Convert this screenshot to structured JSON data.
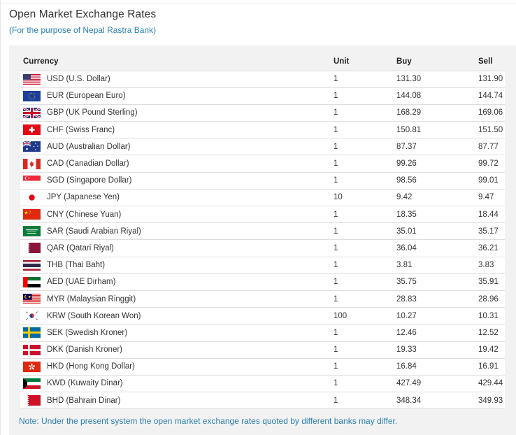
{
  "header": {
    "title": "Open Market Exchange Rates",
    "subtitle": "(For the purpose of Nepal Rastra Bank)"
  },
  "table": {
    "columns": {
      "currency": "Currency",
      "unit": "Unit",
      "buy": "Buy",
      "sell": "Sell"
    },
    "rows": [
      {
        "flag": "us-flag-icon",
        "name": "USD (U.S. Dollar)",
        "unit": "1",
        "buy": "131.30",
        "sell": "131.90"
      },
      {
        "flag": "eu-flag-icon",
        "name": "EUR (European Euro)",
        "unit": "1",
        "buy": "144.08",
        "sell": "144.74"
      },
      {
        "flag": "gb-flag-icon",
        "name": "GBP (UK Pound Sterling)",
        "unit": "1",
        "buy": "168.29",
        "sell": "169.06"
      },
      {
        "flag": "ch-flag-icon",
        "name": "CHF (Swiss Franc)",
        "unit": "1",
        "buy": "150.81",
        "sell": "151.50"
      },
      {
        "flag": "au-flag-icon",
        "name": "AUD (Australian Dollar)",
        "unit": "1",
        "buy": "87.37",
        "sell": "87.77"
      },
      {
        "flag": "ca-flag-icon",
        "name": "CAD (Canadian Dollar)",
        "unit": "1",
        "buy": "99.26",
        "sell": "99.72"
      },
      {
        "flag": "sg-flag-icon",
        "name": "SGD (Singapore Dollar)",
        "unit": "1",
        "buy": "98.56",
        "sell": "99.01"
      },
      {
        "flag": "jp-flag-icon",
        "name": "JPY (Japanese Yen)",
        "unit": "10",
        "buy": "9.42",
        "sell": "9.47"
      },
      {
        "flag": "cn-flag-icon",
        "name": "CNY (Chinese Yuan)",
        "unit": "1",
        "buy": "18.35",
        "sell": "18.44"
      },
      {
        "flag": "sa-flag-icon",
        "name": "SAR (Saudi Arabian Riyal)",
        "unit": "1",
        "buy": "35.01",
        "sell": "35.17"
      },
      {
        "flag": "qa-flag-icon",
        "name": "QAR (Qatari Riyal)",
        "unit": "1",
        "buy": "36.04",
        "sell": "36.21"
      },
      {
        "flag": "th-flag-icon",
        "name": "THB (Thai Baht)",
        "unit": "1",
        "buy": "3.81",
        "sell": "3.83"
      },
      {
        "flag": "ae-flag-icon",
        "name": "AED (UAE Dirham)",
        "unit": "1",
        "buy": "35.75",
        "sell": "35.91"
      },
      {
        "flag": "my-flag-icon",
        "name": "MYR (Malaysian Ringgit)",
        "unit": "1",
        "buy": "28.83",
        "sell": "28.96"
      },
      {
        "flag": "kr-flag-icon",
        "name": "KRW (South Korean Won)",
        "unit": "100",
        "buy": "10.27",
        "sell": "10.31"
      },
      {
        "flag": "se-flag-icon",
        "name": "SEK (Swedish Kroner)",
        "unit": "1",
        "buy": "12.46",
        "sell": "12.52"
      },
      {
        "flag": "dk-flag-icon",
        "name": "DKK (Danish Kroner)",
        "unit": "1",
        "buy": "19.33",
        "sell": "19.42"
      },
      {
        "flag": "hk-flag-icon",
        "name": "HKD (Hong Kong Dollar)",
        "unit": "1",
        "buy": "16.84",
        "sell": "16.91"
      },
      {
        "flag": "kw-flag-icon",
        "name": "KWD (Kuwaity Dinar)",
        "unit": "1",
        "buy": "427.49",
        "sell": "429.44"
      },
      {
        "flag": "bh-flag-icon",
        "name": "BHD (Bahrain Dinar)",
        "unit": "1",
        "buy": "348.34",
        "sell": "349.93"
      }
    ]
  },
  "footer": {
    "note": "Note: Under the present system the open market exchange rates quoted by different banks may differ."
  },
  "colors": {
    "accent": "#2a7fb0",
    "panel_bg": "#f2f2f2",
    "row_bg": "#ffffff"
  }
}
